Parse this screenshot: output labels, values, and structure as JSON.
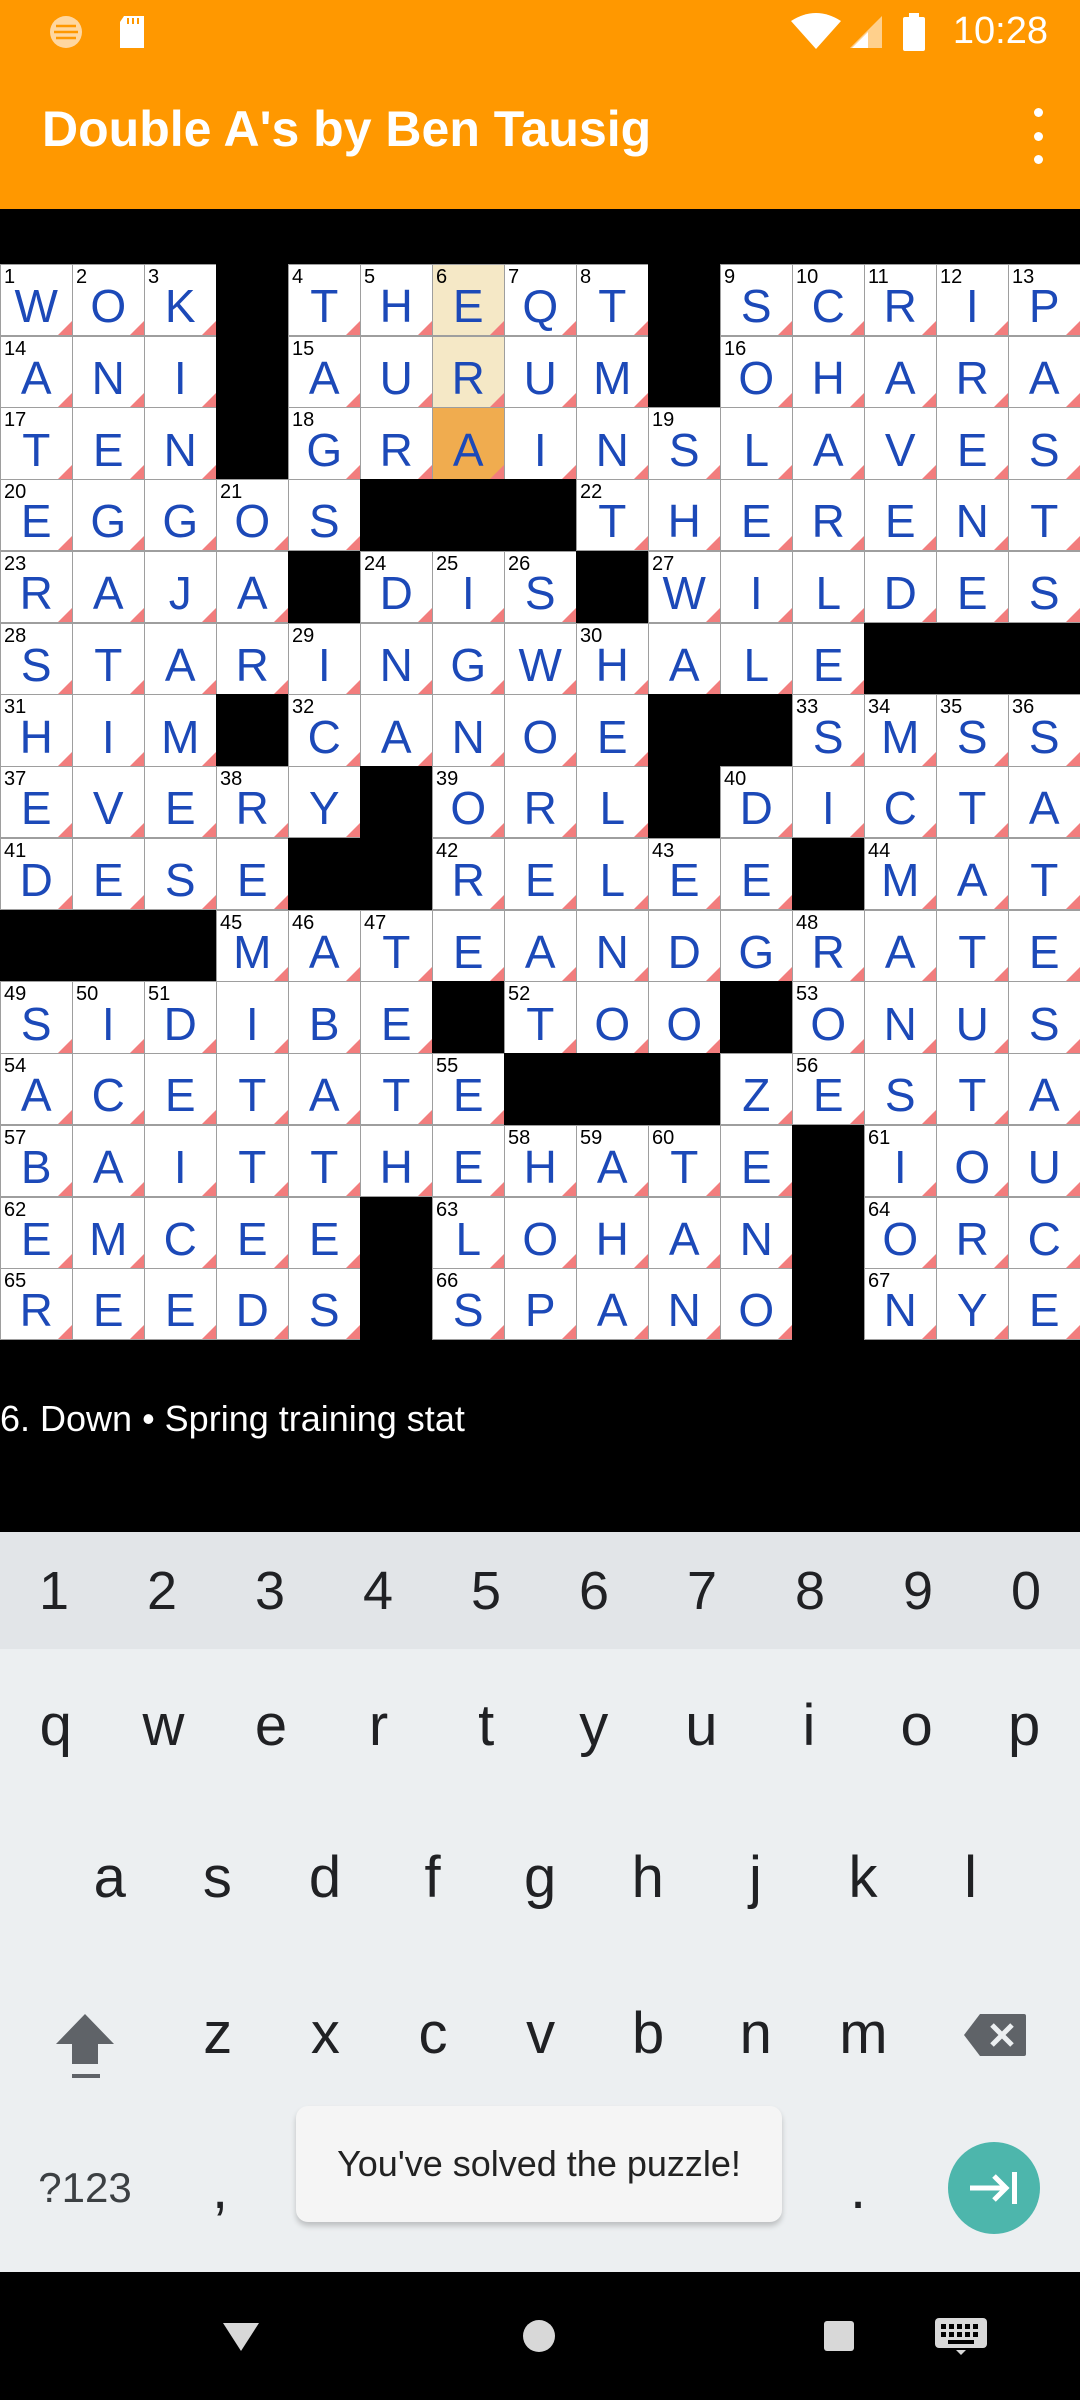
{
  "status_bar": {
    "time": "10:28",
    "icons": [
      "sun-logo-icon",
      "sd-card-icon",
      "wifi-icon",
      "signal-icon",
      "battery-icon"
    ]
  },
  "app_bar": {
    "title": "Double A's by Ben Tausig",
    "overflow_icon": "more-vert-icon"
  },
  "colors": {
    "app_bar": "#FF9800",
    "letter": "#1c49b8",
    "word_highlight": "#F5E8C6",
    "cursor": "#F0AC4F",
    "corner_marker": "#f27d7d",
    "enter_key": "#4DB6AC"
  },
  "puzzle": {
    "rows": [
      "WOK.THEQT.SCRIP",
      "ANI.AURUM.OHARA",
      "TEN.GRAINSLAVES",
      "EGGOS...THERENT",
      "RAJA.DIS.WILDES",
      "STARINGWHALE...",
      "HIM.CANOE..SMSS",
      "EVERY.ORL.DICTA",
      "DESE..RELEE.MAT",
      "...MATEANDGRATE",
      "SIDIBE.TOO.ONUS",
      "ACETATE...ZESTA",
      "BAITTHEHATE.IOU",
      "EMCEE.LOHAN.ORC",
      "REEDS.SPANO.NYE"
    ],
    "numbers": [
      [
        1,
        2,
        3,
        0,
        4,
        5,
        6,
        7,
        8,
        0,
        9,
        10,
        11,
        12,
        13
      ],
      [
        14,
        0,
        0,
        0,
        15,
        0,
        0,
        0,
        0,
        0,
        16,
        0,
        0,
        0,
        0
      ],
      [
        17,
        0,
        0,
        0,
        18,
        0,
        0,
        0,
        0,
        19,
        0,
        0,
        0,
        0,
        0
      ],
      [
        20,
        0,
        0,
        21,
        0,
        0,
        0,
        0,
        22,
        0,
        0,
        0,
        0,
        0,
        0
      ],
      [
        23,
        0,
        0,
        0,
        0,
        24,
        25,
        26,
        0,
        27,
        0,
        0,
        0,
        0,
        0
      ],
      [
        28,
        0,
        0,
        0,
        29,
        0,
        0,
        0,
        30,
        0,
        0,
        0,
        0,
        0,
        0
      ],
      [
        31,
        0,
        0,
        0,
        32,
        0,
        0,
        0,
        0,
        0,
        0,
        33,
        34,
        35,
        36
      ],
      [
        37,
        0,
        0,
        38,
        0,
        0,
        39,
        0,
        0,
        0,
        40,
        0,
        0,
        0,
        0
      ],
      [
        41,
        0,
        0,
        0,
        0,
        0,
        42,
        0,
        0,
        43,
        0,
        0,
        44,
        0,
        0
      ],
      [
        0,
        0,
        0,
        45,
        46,
        47,
        0,
        0,
        0,
        0,
        0,
        48,
        0,
        0,
        0
      ],
      [
        49,
        50,
        51,
        0,
        0,
        0,
        0,
        52,
        0,
        0,
        0,
        53,
        0,
        0,
        0
      ],
      [
        54,
        0,
        0,
        0,
        0,
        0,
        55,
        0,
        0,
        0,
        0,
        56,
        0,
        0,
        0
      ],
      [
        57,
        0,
        0,
        0,
        0,
        0,
        0,
        58,
        59,
        60,
        0,
        0,
        61,
        0,
        0
      ],
      [
        62,
        0,
        0,
        0,
        0,
        0,
        63,
        0,
        0,
        0,
        0,
        0,
        64,
        0,
        0
      ],
      [
        65,
        0,
        0,
        0,
        0,
        0,
        66,
        0,
        0,
        0,
        0,
        0,
        67,
        0,
        0
      ]
    ],
    "active_column": 6,
    "active_rows": [
      0,
      1,
      2
    ],
    "cursor": {
      "row": 2,
      "col": 6
    }
  },
  "clue": {
    "text": "6. Down • Spring training stat"
  },
  "keyboard": {
    "number_row": [
      "1",
      "2",
      "3",
      "4",
      "5",
      "6",
      "7",
      "8",
      "9",
      "0"
    ],
    "row1": [
      "q",
      "w",
      "e",
      "r",
      "t",
      "y",
      "u",
      "i",
      "o",
      "p"
    ],
    "row2": [
      "a",
      "s",
      "d",
      "f",
      "g",
      "h",
      "j",
      "k",
      "l"
    ],
    "row3": [
      "z",
      "x",
      "c",
      "v",
      "b",
      "n",
      "m"
    ],
    "symbols_key": "?123",
    "comma_key": ",",
    "period_key": ".",
    "shift_icon": "shift-icon",
    "backspace_icon": "backspace-icon",
    "enter_icon": "next-field-icon"
  },
  "toast": {
    "message": "You've solved the puzzle!"
  },
  "nav_bar": {
    "icons": [
      "back-icon",
      "home-icon",
      "recents-icon",
      "keyboard-switch-icon"
    ]
  }
}
